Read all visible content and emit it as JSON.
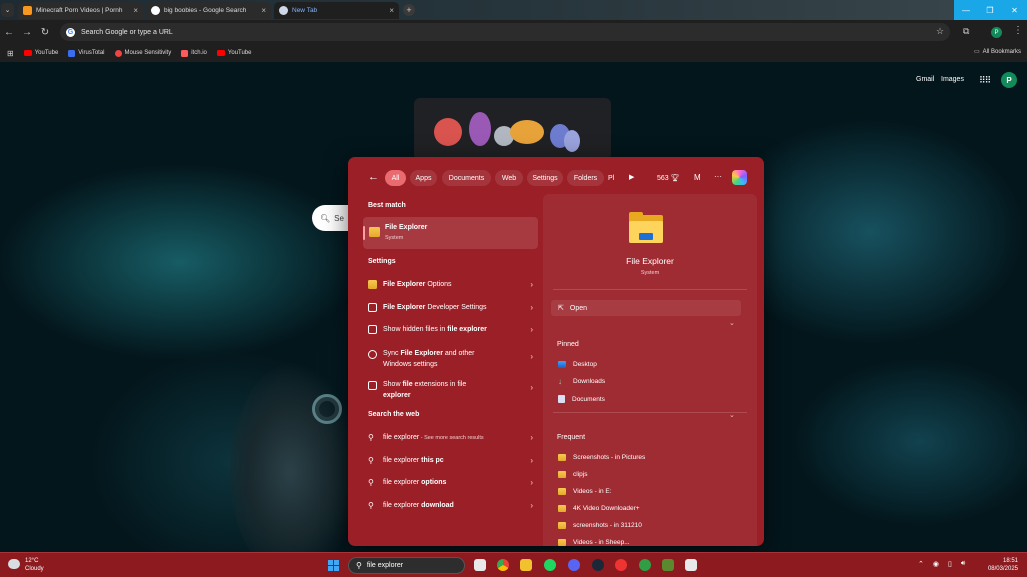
{
  "browser": {
    "tabs": [
      {
        "title": "Minecraft Porn Videos | Pornh",
        "active": false
      },
      {
        "title": "big boobies - Google Search",
        "active": false
      },
      {
        "title": "New Tab",
        "active": true
      }
    ],
    "omnibox_placeholder": "Search Google or type a URL",
    "bookmarks": [
      "YouTube",
      "VirusTotal",
      "Mouse Sensitivity",
      "itch.io",
      "YouTube"
    ],
    "all_bookmarks": "All Bookmarks",
    "profile_initial": "P"
  },
  "ntp": {
    "gmail": "Gmail",
    "images": "Images",
    "avatar_initial": "P",
    "search_prefix": "Se"
  },
  "search_flyout": {
    "filters": [
      "All",
      "Apps",
      "Documents",
      "Web",
      "Settings",
      "Folders",
      "Pl"
    ],
    "points": "563",
    "m_label": "M",
    "best_match_title": "Best match",
    "best_match": {
      "name": "File Explorer",
      "sub": "System"
    },
    "settings_title": "Settings",
    "settings_results": [
      {
        "pre": "",
        "bold": "File Explorer",
        "post": " Options",
        "line2": ""
      },
      {
        "pre": "",
        "bold": "File Explorer",
        "post": " Developer Settings",
        "line2": ""
      },
      {
        "pre": "Show hidden files in ",
        "bold": "file explorer",
        "post": "",
        "line2": ""
      },
      {
        "pre": "Sync ",
        "bold": "File Explorer",
        "post": " and other",
        "line2": "Windows settings"
      },
      {
        "pre": "Show ",
        "bold": "file",
        "post": " extensions in file",
        "line2": "explorer"
      }
    ],
    "web_title": "Search the web",
    "web_results": [
      {
        "text": "file explorer",
        "bold": "",
        "hint": " - See more search results"
      },
      {
        "text": "file explorer ",
        "bold": "this pc",
        "hint": ""
      },
      {
        "text": "file explorer ",
        "bold": "options",
        "hint": ""
      },
      {
        "text": "file explorer ",
        "bold": "download",
        "hint": ""
      }
    ],
    "preview": {
      "name": "File Explorer",
      "sub": "System",
      "open_label": "Open",
      "pinned_title": "Pinned",
      "pinned": [
        "Desktop",
        "Downloads",
        "Documents"
      ],
      "frequent_title": "Frequent",
      "frequent": [
        "Screenshots - in Pictures",
        "clipjs",
        "Videos - in E:",
        "4K Video Downloader+",
        "screenshots - in 311210",
        "Videos - in Sheep..."
      ]
    }
  },
  "taskbar": {
    "weather_temp": "12°C",
    "weather_desc": "Cloudy",
    "search_text": "file explorer",
    "time": "18:51",
    "date": "08/03/2025"
  },
  "colors": {
    "flyout_bg": "#9b1f27",
    "active_chip": "#e96a6f",
    "taskbar": "#8d1a1f",
    "tab_active_text": "#7fb4ff"
  }
}
